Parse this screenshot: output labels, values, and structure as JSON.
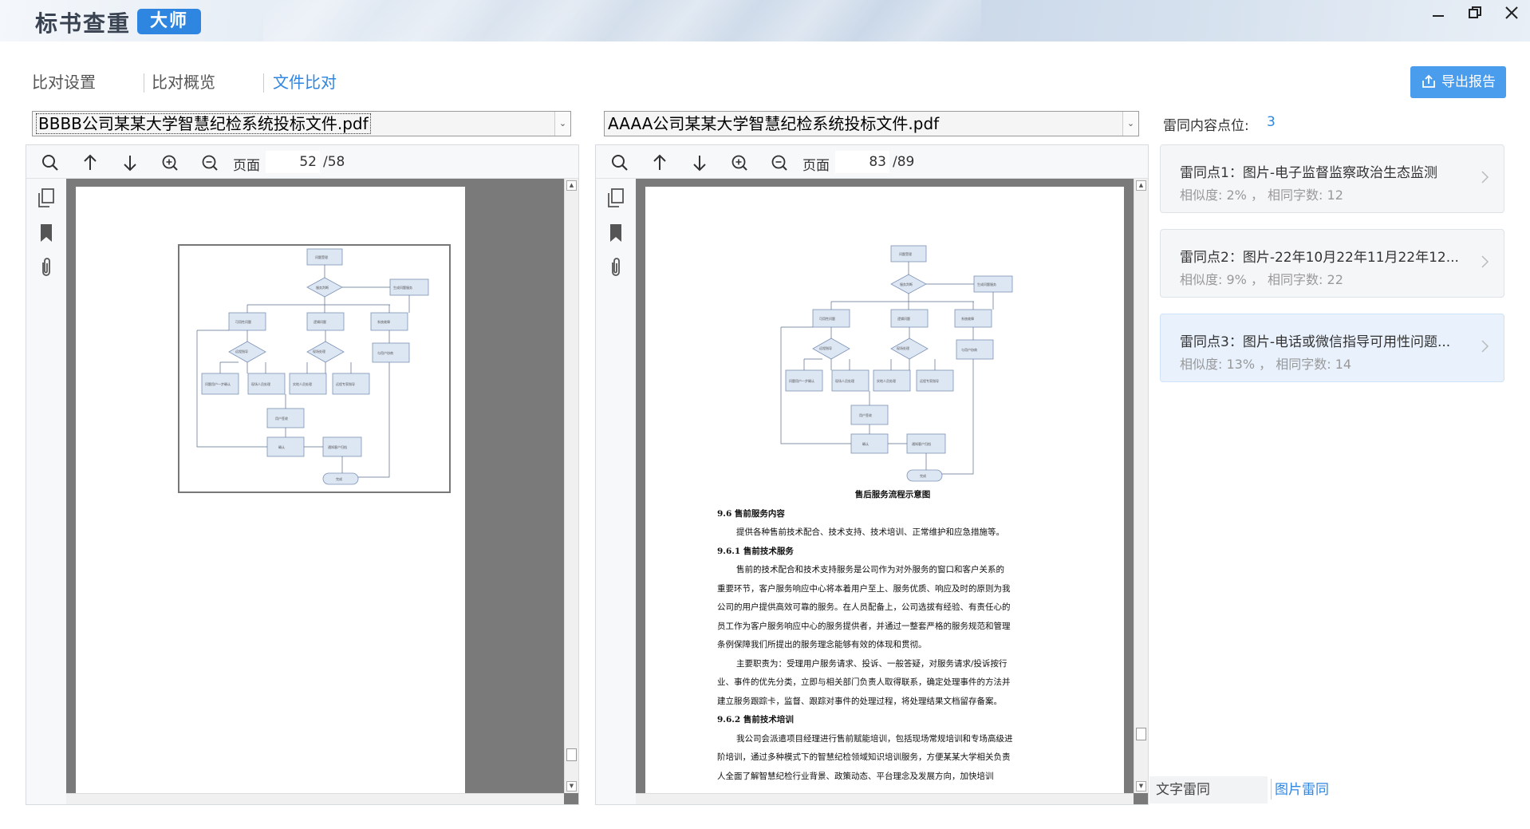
{
  "app": {
    "title": "标书查重",
    "badge": "大师"
  },
  "window": {
    "minimize": "—",
    "maximize": "❐",
    "close": "✕"
  },
  "tabs": [
    {
      "label": "比对设置",
      "active": false
    },
    {
      "label": "比对概览",
      "active": false
    },
    {
      "label": "文件比对",
      "active": true
    }
  ],
  "export_label": "导出报告",
  "left": {
    "file": "BBBB公司某某大学智慧纪检系统投标文件.pdf",
    "page_label": "页面",
    "page": "52",
    "total": "/58"
  },
  "right": {
    "file": "AAAA公司某某大学智慧纪检系统投标文件.pdf",
    "page_label": "页面",
    "page": "83",
    "total": "/89"
  },
  "doc_text": {
    "caption": "售后服务流程示意图",
    "lines": [
      {
        "text": "9.6  售前服务内容",
        "type": "h"
      },
      {
        "text": "提供各种售前技术配合、技术支持、技术培训、正常维护和应急措施等。",
        "type": "ind"
      },
      {
        "text": "9.6.1  售前技术服务",
        "type": "h"
      },
      {
        "text": "售前的技术配合和技术支持服务是公司作为对外服务的窗口和客户关系的",
        "type": "ind"
      },
      {
        "text": "重要环节，客户服务响应中心将本着用户至上、服务优质、响应及时的原则为我",
        "type": "p"
      },
      {
        "text": "公司的用户提供高效可靠的服务。在人员配备上，公司选拔有经验、有责任心的",
        "type": "p"
      },
      {
        "text": "员工作为客户服务响应中心的服务提供者，并通过一整套严格的服务规范和管理",
        "type": "p"
      },
      {
        "text": "条例保障我们所提出的服务理念能够有效的体现和贯彻。",
        "type": "p"
      },
      {
        "text": "主要职责为：受理用户服务请求、投诉、一般答疑，对服务请求/投诉按行",
        "type": "ind"
      },
      {
        "text": "业、事件的优先分类，立即与相关部门负责人取得联系，确定处理事件的方法并",
        "type": "p"
      },
      {
        "text": "建立服务跟踪卡，监督、跟踪对事件的处理过程，将处理结果文档留存备案。",
        "type": "p"
      },
      {
        "text": "9.6.2  售前技术培训",
        "type": "h"
      },
      {
        "text": "我公司会派遣项目经理进行售前赋能培训，包括现场常规培训和专场高级进",
        "type": "ind"
      },
      {
        "text": "阶培训，通过多种模式下的智慧纪检领域知识培训服务，方便某某大学相关负责",
        "type": "p"
      },
      {
        "text": "人全面了解智慧纪检行业背景、政策动态、平台理念及发展方向，加快培训",
        "type": "p"
      }
    ]
  },
  "similar_panel": {
    "label": "雷同内容点位:",
    "count": "3",
    "items": [
      {
        "title": "雷同点1：图片-电子监督监察政治生态监测",
        "meta": "相似度: 2% ，  相同字数:  12",
        "active": false
      },
      {
        "title": "雷同点2：图片-22年10月22年11月22年12...",
        "meta": "相似度: 9% ，  相同字数:  22",
        "active": false
      },
      {
        "title": "雷同点3：图片-电话或微信指导可用性问题...",
        "meta": "相似度: 13% ，  相同字数:  14",
        "active": true
      }
    ]
  },
  "bottom_tabs": [
    {
      "label": "文字雷同",
      "active": false
    },
    {
      "label": "图片雷同",
      "active": true
    }
  ],
  "colors": {
    "accent": "#2f86e0",
    "export_bg": "#4a9cec",
    "doc_bg": "#7a7a7a"
  }
}
